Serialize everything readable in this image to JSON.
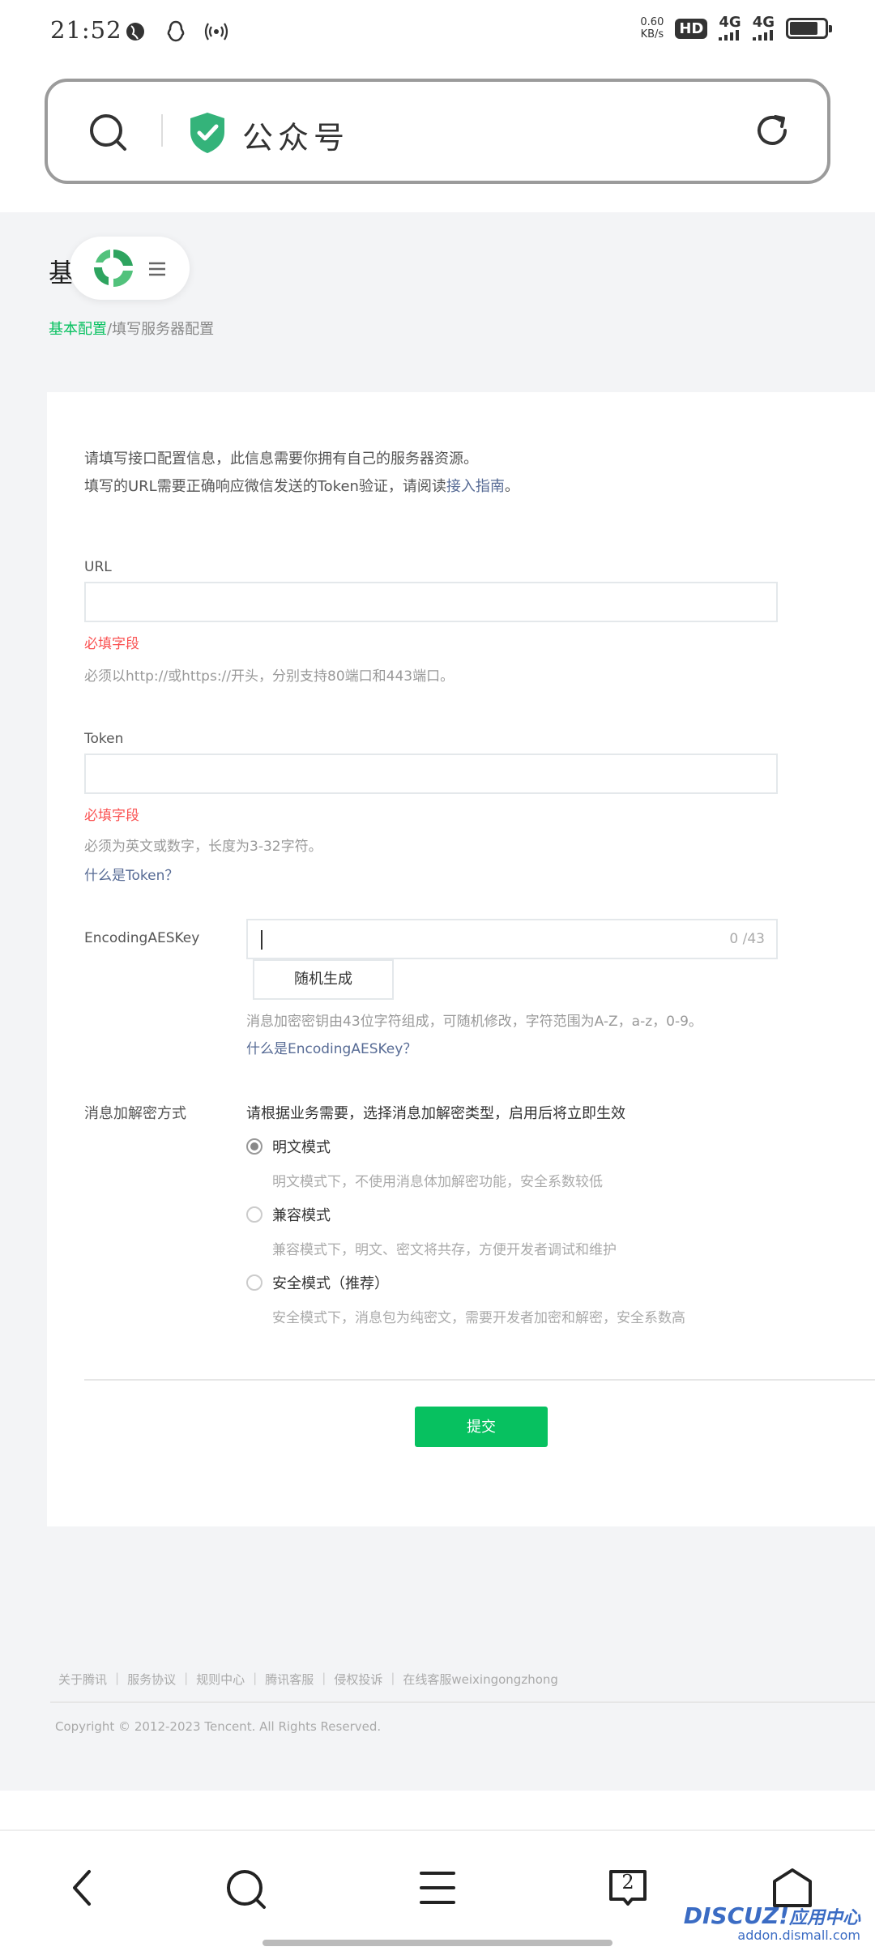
{
  "status_bar": {
    "time": "21:52",
    "speed_value": "0.60",
    "speed_unit": "KB/s",
    "hd_label": "HD",
    "sim1_label": "4G",
    "sim2_label": "4G"
  },
  "address_bar": {
    "title": "公众号"
  },
  "page": {
    "heading": "基",
    "breadcrumb": {
      "active": "基本配置",
      "separator": "/",
      "current": "填写服务器配置"
    }
  },
  "form": {
    "intro_line1": "请填写接口配置信息，此信息需要你拥有自己的服务器资源。",
    "intro_line2_prefix": "填写的URL需要正确响应微信发送的Token验证，请阅读",
    "intro_link": "接入指南",
    "intro_line2_suffix": "。",
    "url": {
      "label": "URL",
      "value": "",
      "error": "必填字段",
      "hint": "必须以http://或https://开头，分别支持80端口和443端口。"
    },
    "token": {
      "label": "Token",
      "value": "",
      "error": "必填字段",
      "hint": "必须为英文或数字，长度为3-32字符。",
      "link": "什么是Token？"
    },
    "aes": {
      "label": "EncodingAESKey",
      "counter": "0 /43",
      "generate_button": "随机生成",
      "hint": "消息加密密钥由43位字符组成，可随机修改，字符范围为A-Z，a-z，0-9。",
      "link": "什么是EncodingAESKey？"
    },
    "encryption": {
      "label": "消息加解密方式",
      "description": "请根据业务需要，选择消息加解密类型，启用后将立即生效",
      "options": [
        {
          "label": "明文模式",
          "desc": "明文模式下，不使用消息体加解密功能，安全系数较低",
          "checked": true
        },
        {
          "label": "兼容模式",
          "desc": "兼容模式下，明文、密文将共存，方便开发者调试和维护",
          "checked": false
        },
        {
          "label": "安全模式（推荐）",
          "desc": "安全模式下，消息包为纯密文，需要开发者加密和解密，安全系数高",
          "checked": false
        }
      ]
    },
    "submit_label": "提交"
  },
  "footer": {
    "links": [
      "关于腾讯",
      "服务协议",
      "规则中心",
      "腾讯客服",
      "侵权投诉",
      "在线客服weixingongzhong"
    ],
    "copyright": "Copyright © 2012-2023 Tencent. All Rights Reserved."
  },
  "bottom_nav": {
    "tab_count": "2"
  },
  "watermark": {
    "title": "DISCUZ!",
    "title_suffix": "应用中心",
    "subtitle": "addon.dismall.com"
  },
  "colors": {
    "accent_green": "#07c160",
    "link_blue": "#576b95",
    "error_red": "#fa5151"
  }
}
